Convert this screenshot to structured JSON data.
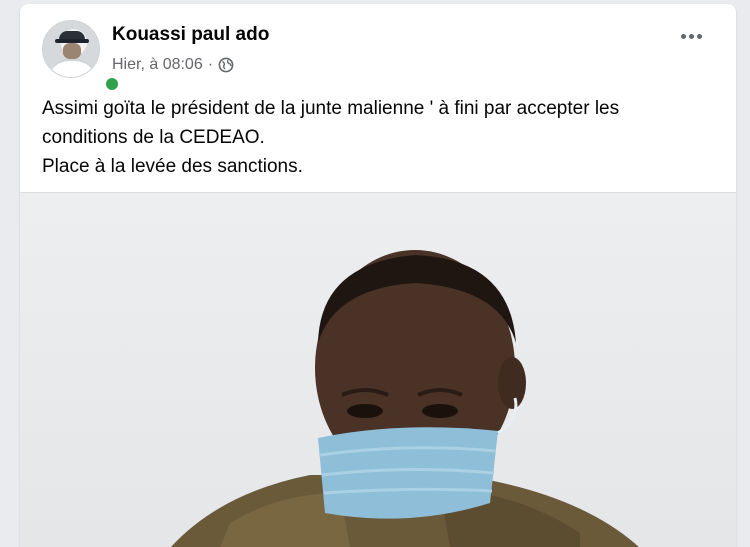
{
  "post": {
    "author": "Kouassi paul ado",
    "timestamp": "Hier, à 08:06",
    "separator": "·",
    "privacy_icon": "globe-icon",
    "more_icon": "more-options-icon",
    "text_lines": [
      "Assimi goïta le président de la junte malienne ' à fini par accepter les",
      "conditions de la CEDEAO.",
      "Place à la levée des sanctions."
    ]
  },
  "colors": {
    "online": "#31a24c",
    "secondary_text": "#65676b",
    "primary_text": "#050505"
  }
}
